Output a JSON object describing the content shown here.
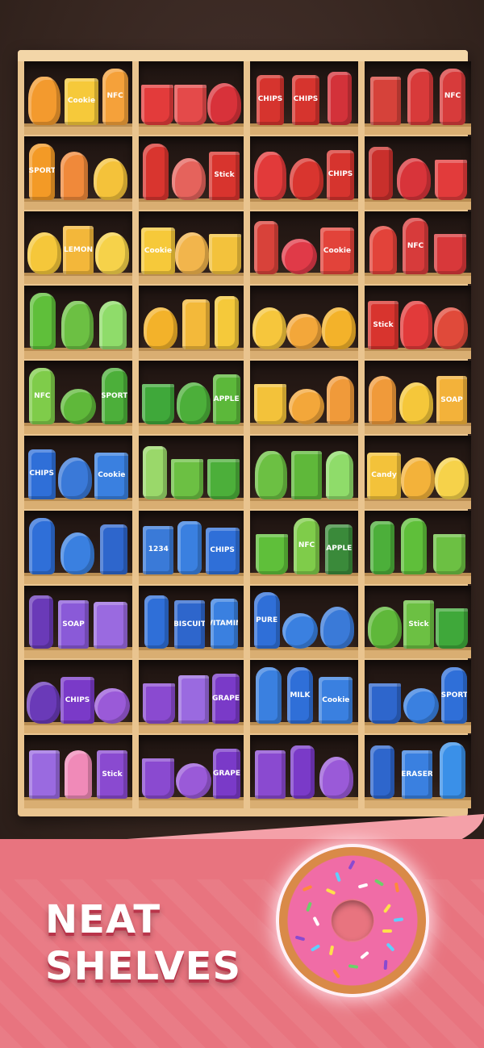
{
  "headline": {
    "line1": "NEAT",
    "line2": "SHELVES"
  },
  "colors": {
    "background": "#3b2a24",
    "cabinet": "#e9c48f",
    "banner": "#e8747f",
    "donut": "#f06ca6"
  },
  "shelves": [
    [
      [
        {
          "name": "gummy-bear",
          "color": "#f39a2e",
          "shape": "bear",
          "label": ""
        },
        {
          "name": "cookie-bag",
          "color": "#f6c93a",
          "shape": "bag",
          "label": "Cookie"
        },
        {
          "name": "nfc-juice-bottle",
          "color": "#f5a13a",
          "shape": "bottle",
          "label": "NFC"
        }
      ],
      [
        {
          "name": "fries",
          "color": "#e33b3b",
          "shape": "cup",
          "label": ""
        },
        {
          "name": "mug",
          "color": "#e44a4a",
          "shape": "cup",
          "label": ""
        },
        {
          "name": "strawberry",
          "color": "#d8323a",
          "shape": "blob",
          "label": ""
        }
      ],
      [
        {
          "name": "chips-can",
          "color": "#d6342e",
          "shape": "can",
          "label": "CHIPS"
        },
        {
          "name": "chips-can",
          "color": "#d6342e",
          "shape": "can",
          "label": "CHIPS"
        },
        {
          "name": "nail-polish",
          "color": "#d3323a",
          "shape": "tall",
          "label": ""
        }
      ],
      [
        {
          "name": "scarf",
          "color": "#d6423a",
          "shape": "box",
          "label": ""
        },
        {
          "name": "detergent-bottle",
          "color": "#d83a3a",
          "shape": "bottle",
          "label": ""
        },
        {
          "name": "nfc-juice-bottle",
          "color": "#d73b3b",
          "shape": "bottle",
          "label": "NFC"
        }
      ]
    ],
    [
      [
        {
          "name": "sport-drink",
          "color": "#f39a26",
          "shape": "bottle",
          "label": "SPORT"
        },
        {
          "name": "popsicle",
          "color": "#f0893a",
          "shape": "popsicle",
          "label": ""
        },
        {
          "name": "bow",
          "color": "#f4c23a",
          "shape": "blob",
          "label": ""
        }
      ],
      [
        {
          "name": "ketchup-bottle",
          "color": "#d9352f",
          "shape": "bottle",
          "label": ""
        },
        {
          "name": "makeup-sponge",
          "color": "#e5635c",
          "shape": "blob",
          "label": ""
        },
        {
          "name": "stick-box",
          "color": "#d8342e",
          "shape": "box",
          "label": "Stick"
        }
      ],
      [
        {
          "name": "gummy-bear",
          "color": "#e23a3a",
          "shape": "bear",
          "label": ""
        },
        {
          "name": "mushroom",
          "color": "#d9352f",
          "shape": "blob",
          "label": ""
        },
        {
          "name": "chips-can",
          "color": "#d6342e",
          "shape": "can",
          "label": "CHIPS"
        }
      ],
      [
        {
          "name": "nail-polish",
          "color": "#c9302c",
          "shape": "tall",
          "label": ""
        },
        {
          "name": "hair-dryer",
          "color": "#d8343a",
          "shape": "blob",
          "label": ""
        },
        {
          "name": "soda-cup",
          "color": "#e23b3b",
          "shape": "cup",
          "label": ""
        }
      ]
    ],
    [
      [
        {
          "name": "rubber-duck",
          "color": "#f5c73a",
          "shape": "blob",
          "label": ""
        },
        {
          "name": "lemon-juice-box",
          "color": "#f3b73a",
          "shape": "box",
          "label": "LEMON"
        },
        {
          "name": "light-bulb",
          "color": "#f6d24a",
          "shape": "blob",
          "label": ""
        }
      ],
      [
        {
          "name": "cookie-bag",
          "color": "#f6c93a",
          "shape": "bag",
          "label": "Cookie"
        },
        {
          "name": "makeup-sponge",
          "color": "#f2b54c",
          "shape": "blob",
          "label": ""
        },
        {
          "name": "mug",
          "color": "#f3c23c",
          "shape": "cup",
          "label": ""
        }
      ],
      [
        {
          "name": "blender",
          "color": "#d8423a",
          "shape": "tall",
          "label": ""
        },
        {
          "name": "lollipop",
          "color": "#e03a48",
          "shape": "round",
          "label": ""
        },
        {
          "name": "cookie-bag",
          "color": "#e2433a",
          "shape": "bag",
          "label": "Cookie"
        }
      ],
      [
        {
          "name": "watermelon-popsicle",
          "color": "#e2433a",
          "shape": "popsicle",
          "label": ""
        },
        {
          "name": "nfc-juice-bottle",
          "color": "#d73b3b",
          "shape": "bottle",
          "label": "NFC"
        },
        {
          "name": "trash-bin",
          "color": "#d8383a",
          "shape": "cup",
          "label": ""
        }
      ]
    ],
    [
      [
        {
          "name": "detergent-bottle",
          "color": "#5fbf3a",
          "shape": "bottle",
          "label": ""
        },
        {
          "name": "gummy-bear",
          "color": "#6cc043",
          "shape": "bear",
          "label": ""
        },
        {
          "name": "popsicle",
          "color": "#8fdc6a",
          "shape": "popsicle",
          "label": ""
        }
      ],
      [
        {
          "name": "bell-pepper",
          "color": "#f3b22a",
          "shape": "blob",
          "label": ""
        },
        {
          "name": "pill-bottle",
          "color": "#f3b93a",
          "shape": "can",
          "label": ""
        },
        {
          "name": "banana",
          "color": "#f5c93a",
          "shape": "tall",
          "label": ""
        }
      ],
      [
        {
          "name": "chick",
          "color": "#f6c63c",
          "shape": "blob",
          "label": ""
        },
        {
          "name": "paw-lollipop",
          "color": "#f3a73a",
          "shape": "round",
          "label": ""
        },
        {
          "name": "bell-pepper",
          "color": "#f3b22a",
          "shape": "blob",
          "label": ""
        }
      ],
      [
        {
          "name": "stick-box",
          "color": "#d8342e",
          "shape": "box",
          "label": "Stick"
        },
        {
          "name": "gummy-bear",
          "color": "#e23a3a",
          "shape": "bear",
          "label": ""
        },
        {
          "name": "mushroom",
          "color": "#e04a3a",
          "shape": "blob",
          "label": ""
        }
      ]
    ],
    [
      [
        {
          "name": "nfc-juice-bottle",
          "color": "#7fcc4a",
          "shape": "bottle",
          "label": "NFC"
        },
        {
          "name": "apple",
          "color": "#5fb83a",
          "shape": "round",
          "label": ""
        },
        {
          "name": "sport-drink",
          "color": "#4caf3a",
          "shape": "bottle",
          "label": "SPORT"
        }
      ],
      [
        {
          "name": "trash-bin",
          "color": "#3fa83a",
          "shape": "cup",
          "label": ""
        },
        {
          "name": "bell-pepper",
          "color": "#4caf3a",
          "shape": "blob",
          "label": ""
        },
        {
          "name": "apple-juice-can",
          "color": "#5cb83a",
          "shape": "can",
          "label": "APPLE"
        }
      ],
      [
        {
          "name": "pencil-cup",
          "color": "#f3c23a",
          "shape": "cup",
          "label": ""
        },
        {
          "name": "lollipop",
          "color": "#f3a73a",
          "shape": "round",
          "label": ""
        },
        {
          "name": "popsicle",
          "color": "#f09a3a",
          "shape": "popsicle",
          "label": ""
        }
      ],
      [
        {
          "name": "popsicle",
          "color": "#f09a3a",
          "shape": "popsicle",
          "label": ""
        },
        {
          "name": "rubber-duck",
          "color": "#f5c73a",
          "shape": "blob",
          "label": ""
        },
        {
          "name": "soap",
          "color": "#f3b23a",
          "shape": "box",
          "label": "SOAP"
        }
      ]
    ],
    [
      [
        {
          "name": "chips-can",
          "color": "#2f6fd8",
          "shape": "can",
          "label": "CHIPS"
        },
        {
          "name": "cap",
          "color": "#3a79d8",
          "shape": "blob",
          "label": ""
        },
        {
          "name": "cookie-bag",
          "color": "#3a80e0",
          "shape": "bag",
          "label": "Cookie"
        }
      ],
      [
        {
          "name": "green-onion",
          "color": "#9ad86a",
          "shape": "tall",
          "label": ""
        },
        {
          "name": "coffee-cup",
          "color": "#6cc043",
          "shape": "cup",
          "label": ""
        },
        {
          "name": "mug",
          "color": "#4caf3a",
          "shape": "cup",
          "label": ""
        }
      ],
      [
        {
          "name": "gummy-bear",
          "color": "#6cc043",
          "shape": "bear",
          "label": ""
        },
        {
          "name": "notebook",
          "color": "#5fb83a",
          "shape": "box",
          "label": ""
        },
        {
          "name": "popsicle",
          "color": "#8fdc6a",
          "shape": "popsicle",
          "label": ""
        }
      ],
      [
        {
          "name": "candy-bag",
          "color": "#f3c23a",
          "shape": "bag",
          "label": "Candy"
        },
        {
          "name": "scissors",
          "color": "#f3b23a",
          "shape": "blob",
          "label": ""
        },
        {
          "name": "light-bulb",
          "color": "#f6d24a",
          "shape": "blob",
          "label": ""
        }
      ]
    ],
    [
      [
        {
          "name": "lotion-bottle",
          "color": "#2f6fd8",
          "shape": "bottle",
          "label": ""
        },
        {
          "name": "hair-dryer",
          "color": "#3a80e0",
          "shape": "blob",
          "label": ""
        },
        {
          "name": "tumbler",
          "color": "#2e66cc",
          "shape": "can",
          "label": ""
        }
      ],
      [
        {
          "name": "calculator",
          "color": "#3a7ad8",
          "shape": "box",
          "label": "1234"
        },
        {
          "name": "ruler",
          "color": "#3a80e0",
          "shape": "tall",
          "label": ""
        },
        {
          "name": "chips-bag",
          "color": "#2f6fd8",
          "shape": "bag",
          "label": "CHIPS"
        }
      ],
      [
        {
          "name": "candle",
          "color": "#5fbf3a",
          "shape": "cup",
          "label": ""
        },
        {
          "name": "nfc-juice-bottle",
          "color": "#7fcc4a",
          "shape": "bottle",
          "label": "NFC"
        },
        {
          "name": "apple-juice-can",
          "color": "#3a8a3a",
          "shape": "can",
          "label": "APPLE"
        }
      ],
      [
        {
          "name": "desk-lamp",
          "color": "#4caf3a",
          "shape": "tall",
          "label": ""
        },
        {
          "name": "detergent-bottle",
          "color": "#5fbf3a",
          "shape": "bottle",
          "label": ""
        },
        {
          "name": "coffee-cup",
          "color": "#6cc043",
          "shape": "cup",
          "label": ""
        }
      ]
    ],
    [
      [
        {
          "name": "eggplant",
          "color": "#6a3ab8",
          "shape": "tall",
          "label": ""
        },
        {
          "name": "soap",
          "color": "#8a5ad8",
          "shape": "box",
          "label": "SOAP"
        },
        {
          "name": "pillow",
          "color": "#9a6ae0",
          "shape": "bag",
          "label": ""
        }
      ],
      [
        {
          "name": "tube",
          "color": "#2f6fd8",
          "shape": "tall",
          "label": ""
        },
        {
          "name": "biscuit-box",
          "color": "#2e66cc",
          "shape": "box",
          "label": "BISCUIT"
        },
        {
          "name": "vitamin-jar",
          "color": "#3a80e0",
          "shape": "can",
          "label": "VITAMIN"
        }
      ],
      [
        {
          "name": "pure-water-bottle",
          "color": "#2f6fd8",
          "shape": "bottle",
          "label": "PURE"
        },
        {
          "name": "compact-mirror",
          "color": "#3a80e0",
          "shape": "round",
          "label": ""
        },
        {
          "name": "dress",
          "color": "#3a7ad8",
          "shape": "blob",
          "label": ""
        }
      ],
      [
        {
          "name": "grapes",
          "color": "#5fb83a",
          "shape": "blob",
          "label": ""
        },
        {
          "name": "stick-box",
          "color": "#6cc043",
          "shape": "box",
          "label": "Stick"
        },
        {
          "name": "trash-bin",
          "color": "#3fa83a",
          "shape": "cup",
          "label": ""
        }
      ]
    ],
    [
      [
        {
          "name": "grapes",
          "color": "#6a3ab8",
          "shape": "blob",
          "label": ""
        },
        {
          "name": "chips-bag",
          "color": "#7a3ac8",
          "shape": "bag",
          "label": "CHIPS"
        },
        {
          "name": "compact-mirror",
          "color": "#9a5ad8",
          "shape": "round",
          "label": ""
        }
      ],
      [
        {
          "name": "candle",
          "color": "#8a4ad0",
          "shape": "cup",
          "label": ""
        },
        {
          "name": "perfume-bottle",
          "color": "#9a6ae0",
          "shape": "box",
          "label": ""
        },
        {
          "name": "grape-juice-can",
          "color": "#7a3ac8",
          "shape": "can",
          "label": "GRAPE"
        }
      ],
      [
        {
          "name": "pump-bottle",
          "color": "#3a80e0",
          "shape": "bottle",
          "label": ""
        },
        {
          "name": "milk-bottle",
          "color": "#2f6fd8",
          "shape": "bottle",
          "label": "MILK"
        },
        {
          "name": "cookie-bag",
          "color": "#3a80e0",
          "shape": "bag",
          "label": "Cookie"
        }
      ],
      [
        {
          "name": "soda-cup",
          "color": "#2e66cc",
          "shape": "cup",
          "label": ""
        },
        {
          "name": "tape-measure",
          "color": "#3a80e0",
          "shape": "round",
          "label": ""
        },
        {
          "name": "sport-drink",
          "color": "#2f6fd8",
          "shape": "bottle",
          "label": "SPORT"
        }
      ]
    ],
    [
      [
        {
          "name": "perfume-bottle",
          "color": "#9a6ae0",
          "shape": "box",
          "label": ""
        },
        {
          "name": "popsicle",
          "color": "#f08ab8",
          "shape": "popsicle",
          "label": ""
        },
        {
          "name": "stick-box",
          "color": "#8a4ad0",
          "shape": "box",
          "label": "Stick"
        }
      ],
      [
        {
          "name": "coffee-cup",
          "color": "#8a4ad0",
          "shape": "cup",
          "label": ""
        },
        {
          "name": "paw-lollipop",
          "color": "#9a5ad8",
          "shape": "round",
          "label": ""
        },
        {
          "name": "grape-juice-can",
          "color": "#7a3ac8",
          "shape": "can",
          "label": "GRAPE"
        }
      ],
      [
        {
          "name": "scarf",
          "color": "#8a4ad0",
          "shape": "box",
          "label": ""
        },
        {
          "name": "nail-polish",
          "color": "#7a3ac8",
          "shape": "tall",
          "label": ""
        },
        {
          "name": "hair-dryer",
          "color": "#9a5ad8",
          "shape": "blob",
          "label": ""
        }
      ],
      [
        {
          "name": "desk-lamp",
          "color": "#2e66cc",
          "shape": "tall",
          "label": ""
        },
        {
          "name": "eraser",
          "color": "#3a80e0",
          "shape": "box",
          "label": "ERASER"
        },
        {
          "name": "water-bottle",
          "color": "#3a90e8",
          "shape": "bottle",
          "label": ""
        }
      ]
    ]
  ]
}
